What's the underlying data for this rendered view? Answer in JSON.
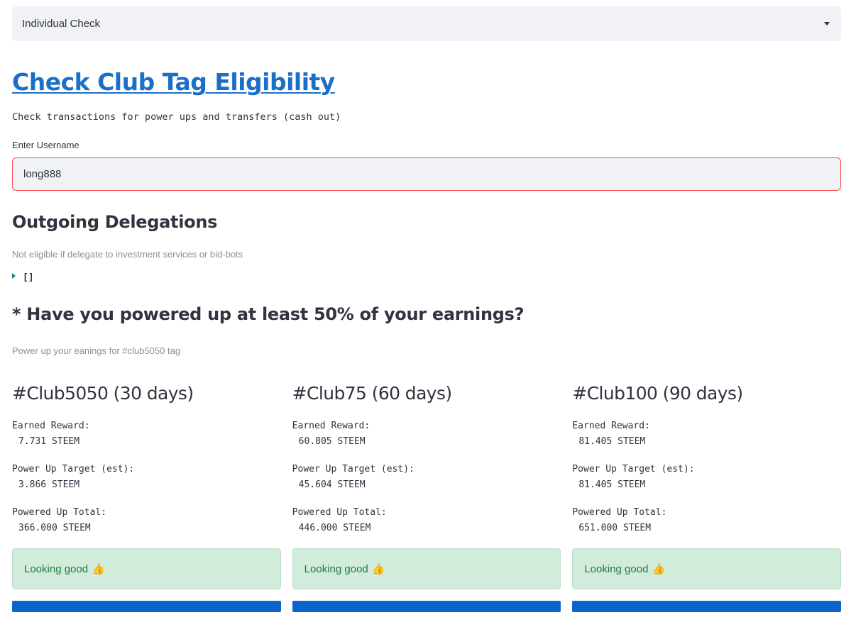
{
  "selector": {
    "value": "Individual Check"
  },
  "title": "Check Club Tag Eligibility",
  "description": "Check transactions for power ups and transfers (cash out)",
  "username": {
    "label": "Enter Username",
    "value": "long888"
  },
  "delegations": {
    "heading": "Outgoing Delegations",
    "caption": "Not eligible if delegate to investment services or bid-bots",
    "json_value": "[]"
  },
  "powerup": {
    "heading": "* Have you powered up at least 50% of your earnings?",
    "caption": "Power up your eanings for #club5050 tag"
  },
  "labels": {
    "earned": "Earned Reward:",
    "target": "Power Up Target (est):",
    "total": "Powered Up Total:"
  },
  "clubs": [
    {
      "title": "#Club5050 (30 days)",
      "earned": "7.731 STEEM",
      "target": "3.866 STEEM",
      "total": "366.000 STEEM",
      "status": "Looking good",
      "status_icon": "👍"
    },
    {
      "title": "#Club75 (60 days)",
      "earned": "60.805 STEEM",
      "target": "45.604 STEEM",
      "total": "446.000 STEEM",
      "status": "Looking good",
      "status_icon": "👍"
    },
    {
      "title": "#Club100 (90 days)",
      "earned": "81.405 STEEM",
      "target": "81.405 STEEM",
      "total": "651.000 STEEM",
      "status": "Looking good",
      "status_icon": "👍"
    }
  ],
  "colors": {
    "link": "#1c6fc7",
    "input_border": "#ff4b4b",
    "success_bg": "#d1ecdb",
    "success_text": "#1a7d3d",
    "progress_bar": "#0a64c9"
  }
}
